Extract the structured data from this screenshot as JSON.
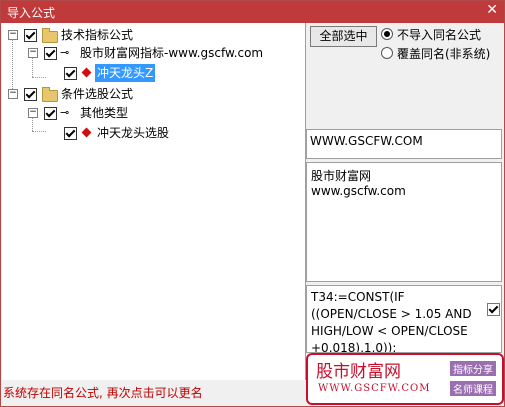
{
  "window": {
    "title": "导入公式",
    "close_glyph": "✕"
  },
  "tree": {
    "nodes": [
      {
        "label": "技术指标公式",
        "icon": "folder-icon"
      },
      {
        "label": "股市财富网指标-www.gscfw.com",
        "icon": "key-icon"
      },
      {
        "label": "冲天龙头Z",
        "icon": "formula-gem-icon",
        "selected": true
      },
      {
        "label": "条件选股公式",
        "icon": "folder-icon"
      },
      {
        "label": "其他类型",
        "icon": "key-icon"
      },
      {
        "label": "冲天龙头选股",
        "icon": "formula-gem-icon"
      }
    ],
    "expand_glyph": "−"
  },
  "actions": {
    "select_all": "全部选中",
    "radio_skip": "不导入同名公式",
    "radio_overwrite": "覆盖同名(非系统)"
  },
  "info": {
    "site": "WWW.GSCFW.COM",
    "desc_line1": "股市财富网",
    "desc_line2": "www.gscfw.com",
    "code_line1": "T34:=CONST(IF",
    "code_line2": "((OPEN/CLOSE > 1.05 AND",
    "code_line3": "HIGH/LOW < OPEN/CLOSE",
    "code_line4": "+0.018),1,0));"
  },
  "status": "系统存在同名公式, 再次点击可以更名",
  "ad": {
    "brand": "股市财富网",
    "url": "WWW.GSCFW.COM",
    "tag1": "指标分享",
    "tag2": "名师课程"
  },
  "colors": {
    "title_bar": "#c0393b",
    "selection": "#3399ff",
    "status_text": "#c00000",
    "brand": "#c8102e"
  }
}
